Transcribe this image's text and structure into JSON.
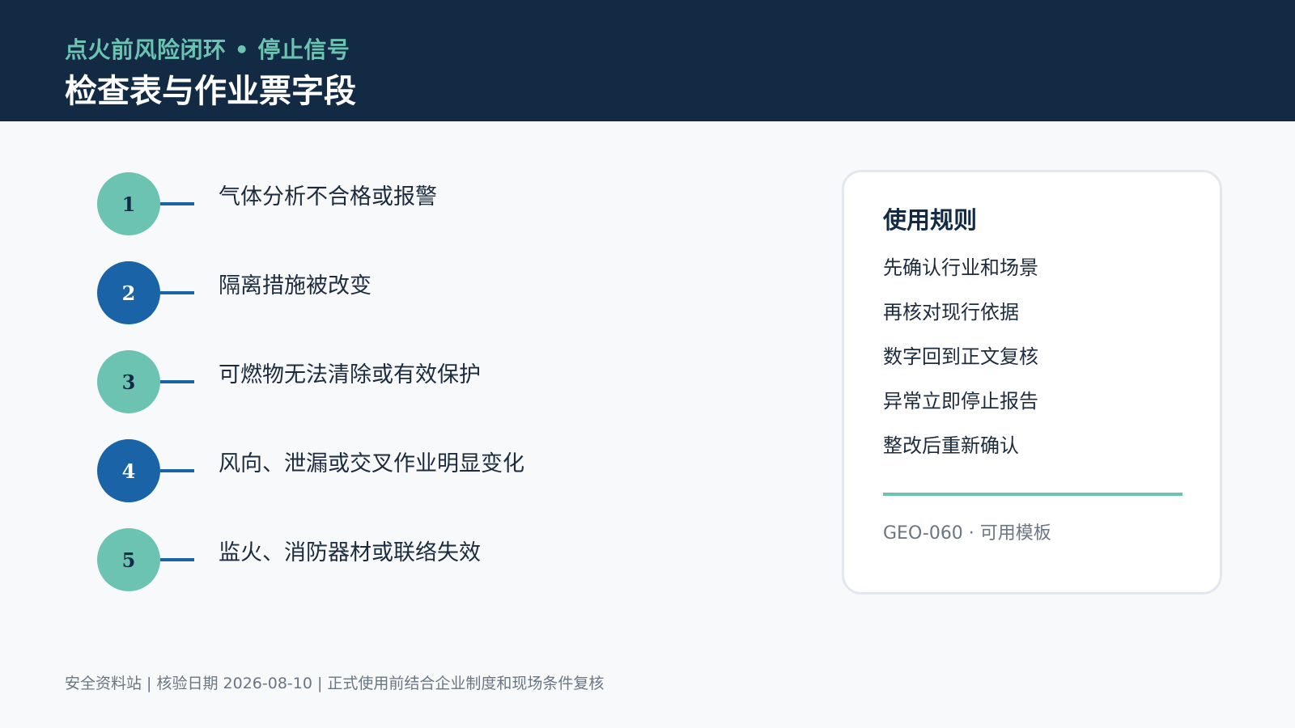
{
  "header": {
    "subtitle": "点火前风险闭环 • 停止信号",
    "title": "检查表与作业票字段"
  },
  "steps": [
    {
      "number": "1",
      "label": "气体分析不合格或报警",
      "color": "#6cc3b1"
    },
    {
      "number": "2",
      "label": "隔离措施被改变",
      "color": "#1a63a6"
    },
    {
      "number": "3",
      "label": "可燃物无法清除或有效保护",
      "color": "#6cc3b1"
    },
    {
      "number": "4",
      "label": "风向、泄漏或交叉作业明显变化",
      "color": "#1a63a6"
    },
    {
      "number": "5",
      "label": "监火、消防器材或联络失效",
      "color": "#6cc3b1"
    }
  ],
  "card": {
    "title": "使用规则",
    "rules": [
      "先确认行业和场景",
      "再核对现行依据",
      "数字回到正文复核",
      "异常立即停止报告",
      "整改后重新确认"
    ],
    "code": "GEO-060 · 可用模板"
  },
  "footer": {
    "text": "安全资料站 | 核验日期 2026-08-10 | 正式使用前结合企业制度和现场条件复核"
  },
  "colors": {
    "header_bg": "#132a45",
    "accent_teal": "#6cc3b1",
    "accent_blue": "#1a63a6",
    "page_bg": "#f7f9fb"
  }
}
